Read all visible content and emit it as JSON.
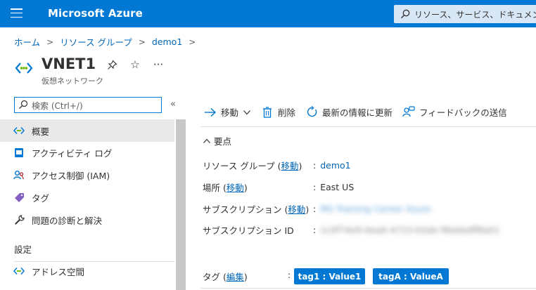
{
  "topbar": {
    "brand": "Microsoft Azure",
    "search_placeholder": "リソース、サービス、ドキュメントの検"
  },
  "breadcrumb": [
    "ホーム",
    "リソース グループ",
    "demo1"
  ],
  "resource": {
    "name": "VNET1",
    "type": "仮想ネットワーク"
  },
  "nav": {
    "search_placeholder": "検索 (Ctrl+/)",
    "collapse": "«",
    "items": [
      {
        "label": "概要",
        "icon": "vnet-icon",
        "selected": true
      },
      {
        "label": "アクティビティ ログ",
        "icon": "activity-log-icon"
      },
      {
        "label": "アクセス制御 (IAM)",
        "icon": "iam-icon"
      },
      {
        "label": "タグ",
        "icon": "tag-icon"
      },
      {
        "label": "問題の診断と解決",
        "icon": "wrench-icon"
      }
    ],
    "section_title": "設定",
    "settings_items": [
      {
        "label": "アドレス空間",
        "icon": "vnet-icon"
      }
    ]
  },
  "commands": {
    "move": "移動",
    "delete": "削除",
    "refresh": "最新の情報に更新",
    "feedback": "フィードバックの送信"
  },
  "essentials": {
    "header": "要点",
    "resource_group_label": "リソース グループ",
    "resource_group_link": "移動",
    "resource_group_value": "demo1",
    "location_label": "場所",
    "location_link": "移動",
    "location_value": "East US",
    "subscription_label": "サブスクリプション",
    "subscription_link": "移動",
    "subscription_value": "MS Training Center Azure",
    "subscription_id_label": "サブスクリプション ID",
    "subscription_id_value": "1c0f74e9-0ea6-4723-b5de-f8ebbdff8a01",
    "tags_label": "タグ",
    "tags_link": "編集",
    "tags": [
      "tag1 : Value1",
      "tagA : ValueA"
    ]
  },
  "colors": {
    "accent": "#0078d4",
    "link": "#0066b8"
  }
}
